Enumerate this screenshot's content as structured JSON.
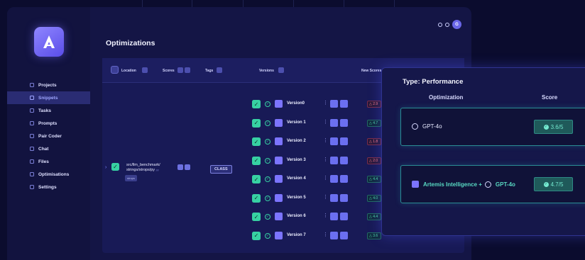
{
  "sidebar": {
    "items": [
      {
        "label": "Projects",
        "icon": "folder-icon"
      },
      {
        "label": "Snippets",
        "icon": "snippet-icon",
        "active": true
      },
      {
        "label": "Tasks",
        "icon": "search-icon"
      },
      {
        "label": "Prompts",
        "icon": "grid-icon"
      },
      {
        "label": "Pair Coder",
        "icon": "code-icon"
      },
      {
        "label": "Chat",
        "icon": "chat-icon"
      },
      {
        "label": "Files",
        "icon": "file-icon"
      },
      {
        "label": "Optimisations",
        "icon": "list-icon"
      },
      {
        "label": "Settings",
        "icon": "gear-icon"
      }
    ]
  },
  "header": {
    "title": "Optimizations",
    "avatar": "G"
  },
  "table": {
    "columns": {
      "location": "Location",
      "scores": "Scores",
      "tags": "Tags",
      "versions": "Versions",
      "new_scores": "New Scores"
    },
    "row": {
      "path": "src/llm_benchmark/ strings/strops/py",
      "lang": "py",
      "tag": "strops",
      "class_chip": "CLASS"
    },
    "versions": [
      {
        "label": "Version0",
        "score": "2.9",
        "status": "red"
      },
      {
        "label": "Version 1",
        "score": "4.7",
        "status": "green"
      },
      {
        "label": "Version 2",
        "score": "1.8",
        "status": "red"
      },
      {
        "label": "Version 3",
        "score": "2.0",
        "status": "red"
      },
      {
        "label": "Version 4",
        "score": "4.4",
        "status": "green"
      },
      {
        "label": "Version 5",
        "score": "4.0",
        "status": "green"
      },
      {
        "label": "Version 6",
        "score": "4.4",
        "status": "green"
      },
      {
        "label": "Version 7",
        "score": "3.6",
        "status": "green"
      }
    ]
  },
  "panel": {
    "title": "Type: Performance",
    "col_optimization": "Optimization",
    "col_score": "Score",
    "rows": [
      {
        "prefix": "",
        "label": "GPT-4o",
        "score": "3.6/5"
      },
      {
        "prefix": "Artemis Intelligence + ",
        "label": "GPT-4o",
        "score": "4.7/5"
      }
    ]
  },
  "colors": {
    "accent": "#7c74ff",
    "teal": "#37d1a3",
    "red": "#ff7b86",
    "background": "#0b0c2e"
  }
}
